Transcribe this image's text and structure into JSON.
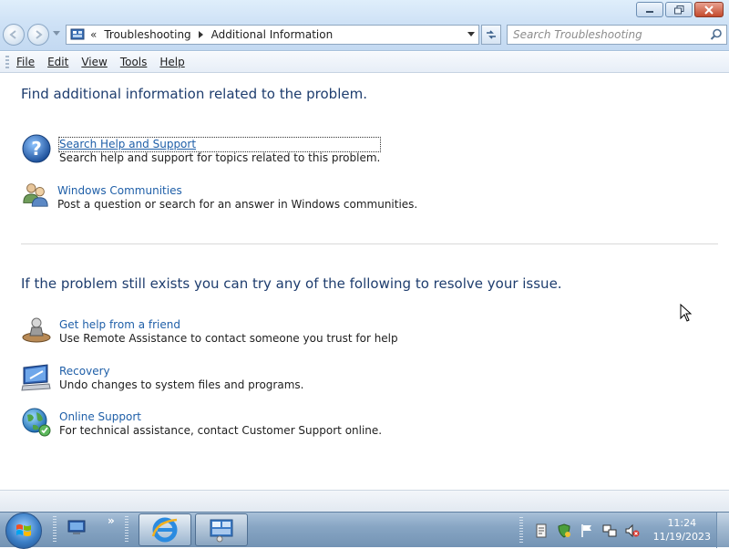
{
  "window": {
    "breadcrumb": [
      "Troubleshooting",
      "Additional Information"
    ],
    "breadcrumb_prefix": "«",
    "search": {
      "placeholder": "Search Troubleshooting",
      "value": ""
    }
  },
  "menu": [
    {
      "label": "File"
    },
    {
      "label": "Edit"
    },
    {
      "label": "View"
    },
    {
      "label": "Tools"
    },
    {
      "label": "Help"
    }
  ],
  "content": {
    "section1": {
      "heading": "Find additional information related to the problem.",
      "items": [
        {
          "icon": "help-question-icon",
          "link": "Search Help and Support",
          "desc": "Search help and support for topics related to this problem."
        },
        {
          "icon": "people-community-icon",
          "link": "Windows Communities",
          "desc": "Post a question or search for an answer in Windows communities."
        }
      ]
    },
    "section2": {
      "heading": "If the problem still exists you can try any of the following to resolve your issue.",
      "items": [
        {
          "icon": "remote-assistance-icon",
          "link": "Get help from a friend",
          "desc": "Use Remote Assistance to contact someone you trust for help"
        },
        {
          "icon": "recovery-monitor-icon",
          "link": "Recovery",
          "desc": "Undo changes to system files and programs."
        },
        {
          "icon": "globe-support-icon",
          "link": "Online Support",
          "desc": "For technical assistance, contact Customer Support online."
        }
      ]
    }
  },
  "taskbar": {
    "clock": {
      "time": "11:24",
      "date": "11/19/2023"
    },
    "quicklaunch_more": "»",
    "tasks": [
      {
        "icon": "internet-explorer-icon"
      },
      {
        "icon": "control-panel-icon"
      }
    ],
    "tray": [
      "notes-icon",
      "security-shield-icon",
      "action-center-flag-icon",
      "network-icon",
      "volume-muted-icon"
    ]
  },
  "colors": {
    "link": "#1f5fa8",
    "heading": "#1e3d6e",
    "taskbar": "#88a6c4"
  }
}
